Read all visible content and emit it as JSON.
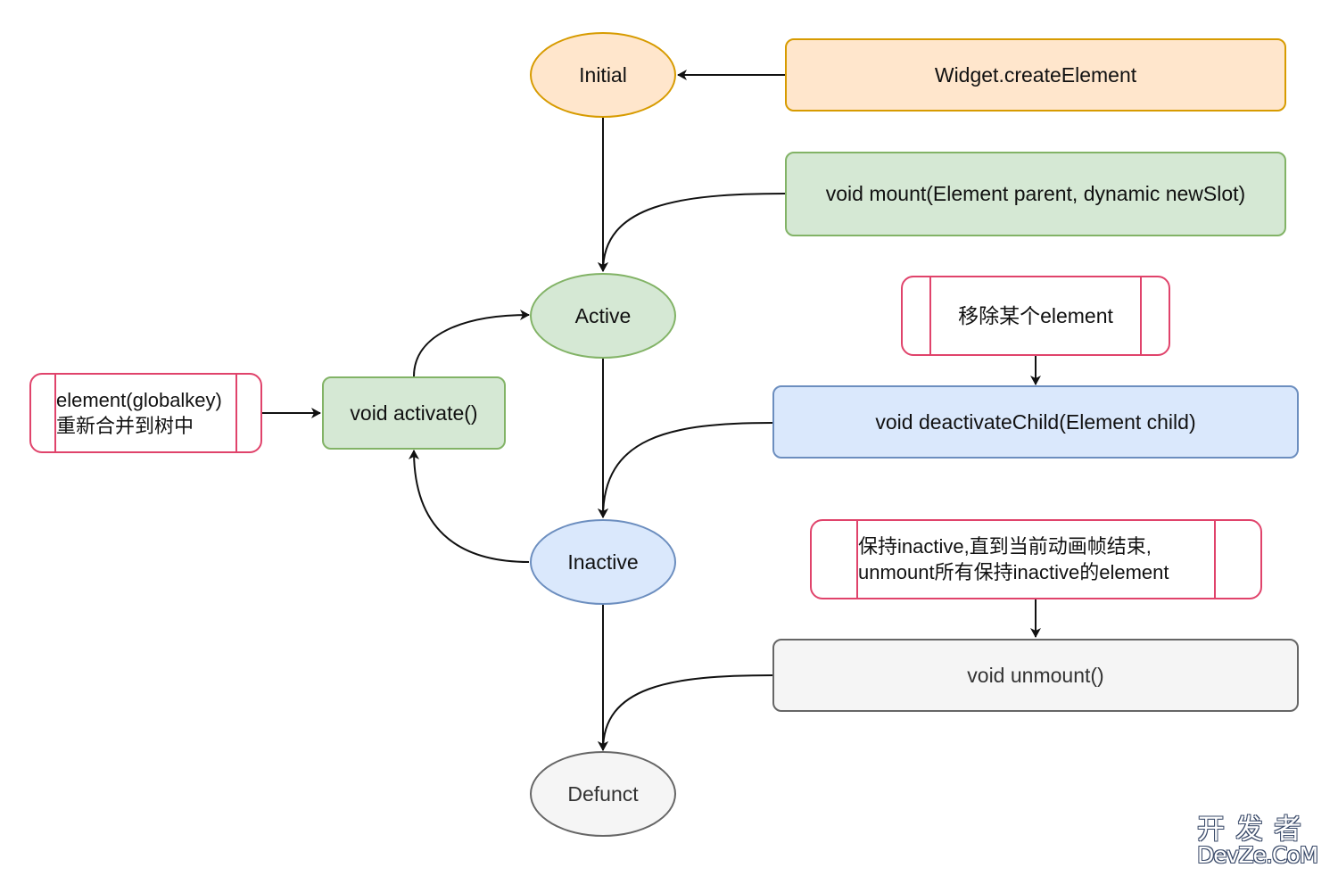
{
  "states": {
    "initial": {
      "label": "Initial",
      "fill": "#ffe6cc",
      "stroke": "#d79b00"
    },
    "active": {
      "label": "Active",
      "fill": "#d5e8d4",
      "stroke": "#82b366"
    },
    "inactive": {
      "label": "Inactive",
      "fill": "#dae8fc",
      "stroke": "#6c8ebf"
    },
    "defunct": {
      "label": "Defunct",
      "fill": "#f5f5f5",
      "stroke": "#666666"
    }
  },
  "methods": {
    "create_element": {
      "label": "Widget.createElement",
      "fill": "#ffe6cc",
      "stroke": "#d79b00"
    },
    "mount": {
      "label": "void mount(Element parent, dynamic newSlot)",
      "fill": "#d5e8d4",
      "stroke": "#82b366"
    },
    "activate": {
      "label": "void activate()",
      "fill": "#d5e8d4",
      "stroke": "#82b366"
    },
    "deactivate_child": {
      "label": "void deactivateChild(Element child)",
      "fill": "#dae8fc",
      "stroke": "#6c8ebf"
    },
    "unmount": {
      "label": "void unmount()",
      "fill": "#f5f5f5",
      "stroke": "#666666"
    }
  },
  "notes": {
    "remove_element": {
      "lines": [
        "移除某个element"
      ]
    },
    "global_key": {
      "lines": [
        "element(globalkey)",
        "重新合并到树中"
      ]
    },
    "keep_inactive": {
      "lines": [
        "保持inactive,直到当前动画帧结束,",
        "unmount所有保持inactive的element"
      ]
    },
    "stroke": "#e0436b"
  },
  "watermark": {
    "line1": "开发者",
    "line2": "DevZe.CoM"
  }
}
